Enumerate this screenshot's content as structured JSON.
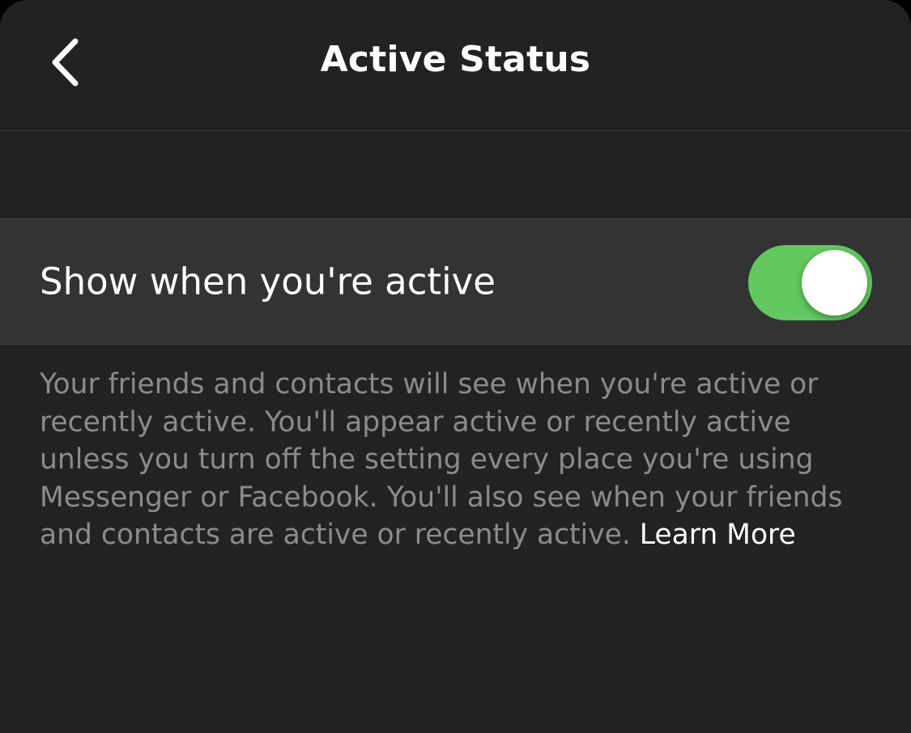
{
  "header": {
    "title": "Active Status",
    "back_icon": "chevron-left-icon"
  },
  "setting": {
    "label": "Show when you're active",
    "toggle_on": true,
    "toggle_color": "#62c85f"
  },
  "description": {
    "text": "Your friends and contacts will see when you're active or recently active. You'll appear active or recently active unless you turn off the setting every place you're using Messenger or Facebook. You'll also see when your friends and contacts are active or recently active.",
    "link_text": "Learn More"
  }
}
